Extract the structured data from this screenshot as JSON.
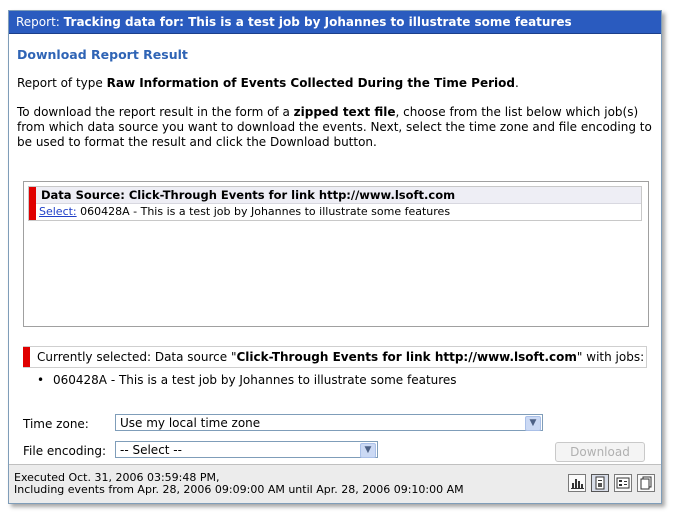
{
  "titlebar": {
    "prefix": "Report:",
    "title": "Tracking data for: This is a test job by Johannes to illustrate some features"
  },
  "main": {
    "section_title": "Download Report Result",
    "report_type_prefix": "Report of type ",
    "report_type": "Raw Information of Events Collected During the Time Period",
    "report_type_suffix": ".",
    "instructions_1": "To download the report result in the form of a ",
    "instructions_bold": "zipped text file",
    "instructions_2": ", choose from the list below which job(s) from which data source you want to download the events. Next, select the time zone and file encoding to be used to format the result and click the Download button."
  },
  "data_source": {
    "heading": "Data Source: Click-Through Events for link http://www.lsoft.com",
    "select_label": "Select:",
    "job": " 060428A - This is a test job by Johannes to illustrate some features"
  },
  "selection": {
    "prefix": "Currently selected: Data source \"",
    "source_name": "Click-Through Events for link http://www.lsoft.com",
    "suffix": "\" with jobs:",
    "bullet": "•",
    "job": "060428A - This is a test job by Johannes to illustrate some features"
  },
  "form": {
    "timezone_label": "Time zone:",
    "timezone_value": "Use my local time zone",
    "encoding_label": "File encoding:",
    "encoding_value": "-- Select --",
    "download_label": "Download"
  },
  "footer": {
    "line1": "Executed Oct. 31, 2006 03:59:48 PM,",
    "line2": "Including events from Apr. 28, 2006 09:09:00 AM until Apr. 28, 2006 09:10:00 AM",
    "icons": [
      "bar-chart-icon",
      "report-icon",
      "data-export-icon",
      "copy-icon"
    ]
  },
  "colors": {
    "titlebar": "#2a5bbf",
    "accent_red": "#e00000",
    "section_title": "#2f64b5",
    "link": "#1f3fc8"
  }
}
